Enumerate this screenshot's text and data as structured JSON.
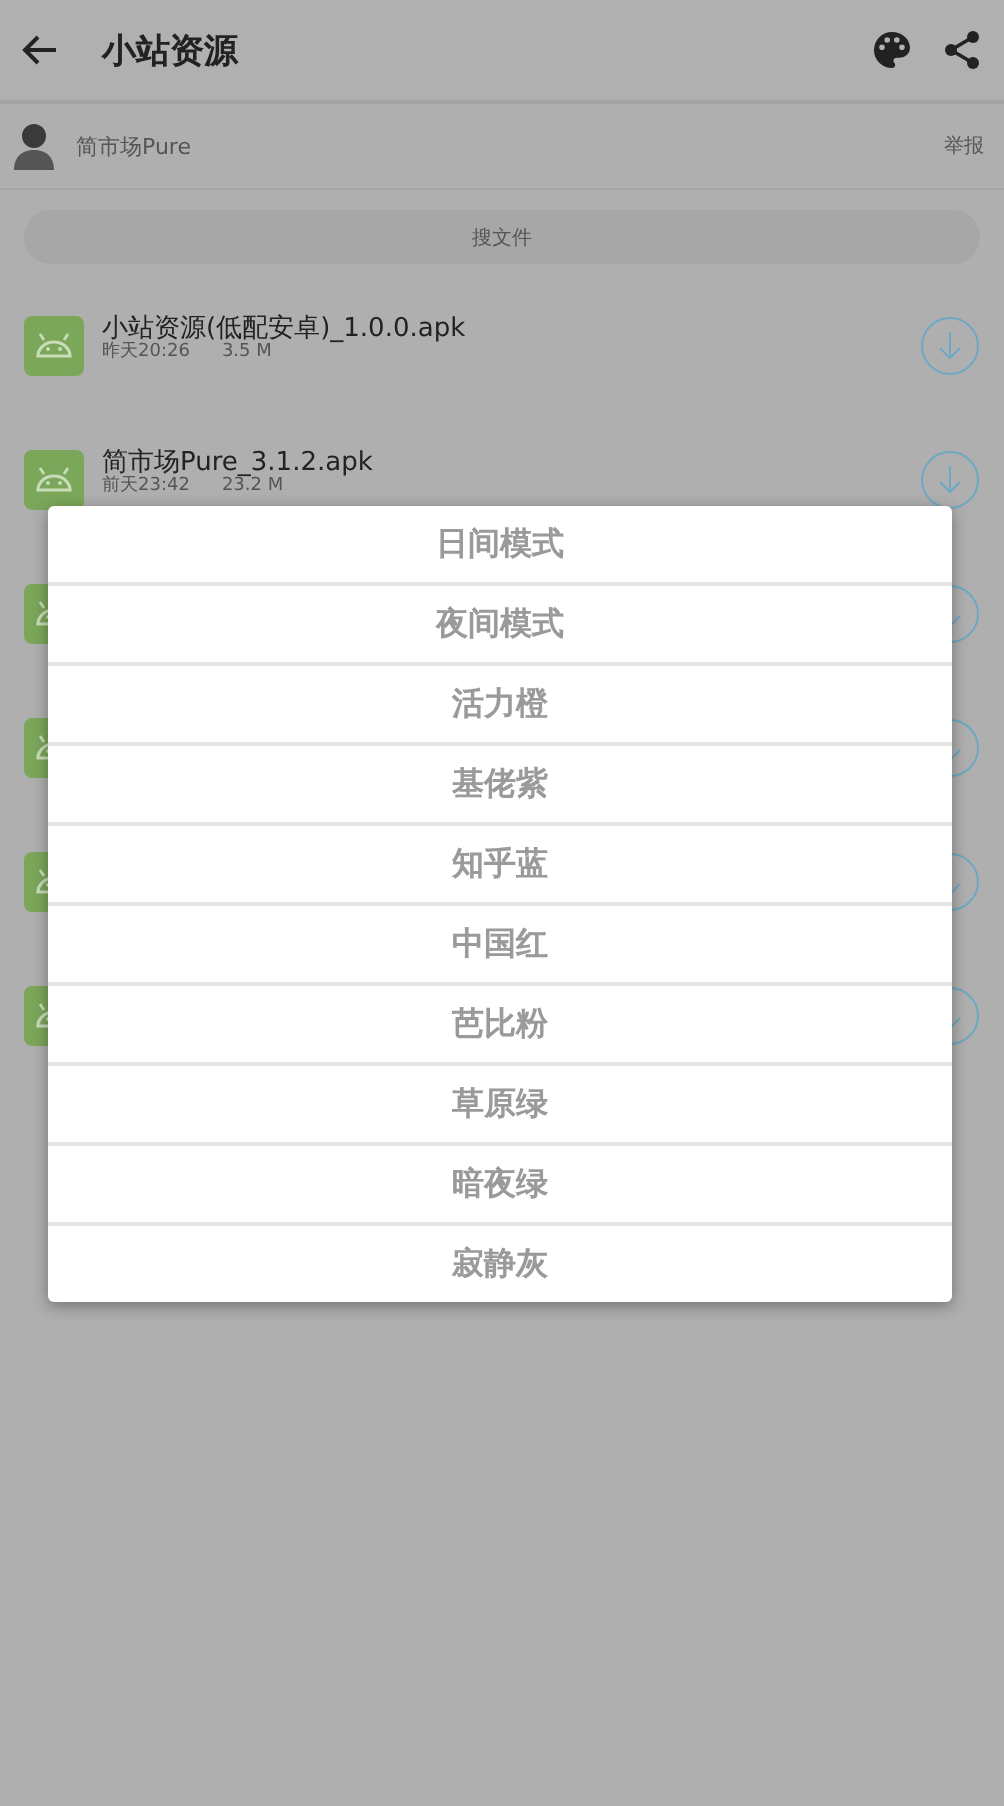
{
  "header": {
    "title": "小站资源"
  },
  "uploader": {
    "name": "简市场Pure",
    "report": "举报"
  },
  "search_button": {
    "label": "搜文件"
  },
  "files": [
    {
      "kind": "file",
      "name": "小站资源(低配安卓)_1.0.0.apk",
      "date": "昨天20:26",
      "size": "3.5 M"
    },
    {
      "kind": "file",
      "name": "简市场Pure_3.1.2.apk",
      "date": "前天23:42",
      "size": "23.2 M"
    },
    {
      "kind": "covered"
    },
    {
      "kind": "covered"
    },
    {
      "kind": "covered"
    },
    {
      "kind": "covered"
    }
  ],
  "theme_menu": [
    "日间模式",
    "夜间模式",
    "活力橙",
    "基佬紫",
    "知乎蓝",
    "中国红",
    "芭比粉",
    "草原绿",
    "暗夜绿",
    "寂静灰"
  ]
}
